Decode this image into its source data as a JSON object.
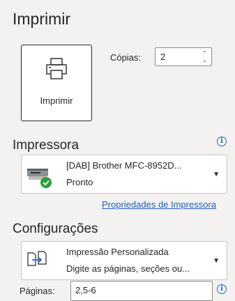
{
  "page_title": "Imprimir",
  "print_button": {
    "label": "Imprimir"
  },
  "copies": {
    "label": "Cópias:",
    "value": "2"
  },
  "printer_section": {
    "title": "Impressora",
    "printer_name": "[DAB] Brother MFC-8952D...",
    "printer_status": "Pronto",
    "properties_link": "Propriedades de Impressora"
  },
  "settings_section": {
    "title": "Configurações",
    "option_title": "Impressão Personalizada",
    "option_desc": "Digite as páginas, seções ou..."
  },
  "pages": {
    "label": "Páginas:",
    "value": "2,5-6"
  },
  "icons": {
    "info": "info-icon",
    "printer": "printer-icon",
    "printer_device": "printer-device-icon",
    "ready_check": "check-icon",
    "custom_print": "custom-print-icon",
    "dropdown": "chevron-down-icon"
  },
  "colors": {
    "accent": "#1f5fbf",
    "ready_green": "#2e9e3a",
    "background": "#f3f2f1"
  },
  "symbols": {
    "info": "i",
    "caret": "▼",
    "up": "⌃",
    "down": "⌄"
  }
}
